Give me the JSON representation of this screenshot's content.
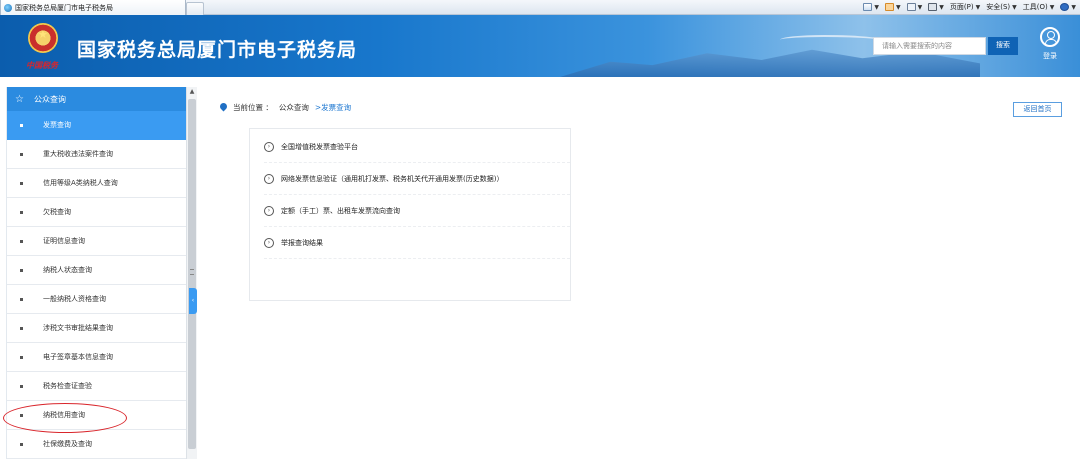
{
  "browser": {
    "tab_title": "国家税务总局厦门市电子税务局",
    "commands": [
      "页面(P)",
      "安全(S)",
      "工具(O)"
    ]
  },
  "header": {
    "site_title": "国家税务总局厦门市电子税务局",
    "emblem_script": "中国税务",
    "search_placeholder": "请输入需要搜索的内容",
    "search_button": "搜索",
    "login_label": "登录"
  },
  "sidebar": {
    "heading": "公众查询",
    "items": [
      {
        "label": "发票查询",
        "active": true
      },
      {
        "label": "重大税收违法案件查询"
      },
      {
        "label": "信用等级A类纳税人查询"
      },
      {
        "label": "欠税查询"
      },
      {
        "label": "证明信息查询"
      },
      {
        "label": "纳税人状态查询"
      },
      {
        "label": "一般纳税人资格查询"
      },
      {
        "label": "涉税文书审批结果查询"
      },
      {
        "label": "电子签章基本信息查询"
      },
      {
        "label": "税务检查证查验"
      },
      {
        "label": "纳税信用查询"
      },
      {
        "label": "社保缴费及查询"
      }
    ]
  },
  "breadcrumb": {
    "prefix": "当前位置 ：",
    "section": "公众查询",
    "current": ">发票查询"
  },
  "back_button": "返回首页",
  "links": [
    "全国增值税发票查验平台",
    "网络发票信息验证（通用机打发票、税务机关代开通用发票(历史数据)）",
    "定额（手工）票、出租车发票流向查询",
    "举报查询结果"
  ],
  "colors": {
    "accent": "#2b8be0",
    "annotation": "#d9262c"
  }
}
